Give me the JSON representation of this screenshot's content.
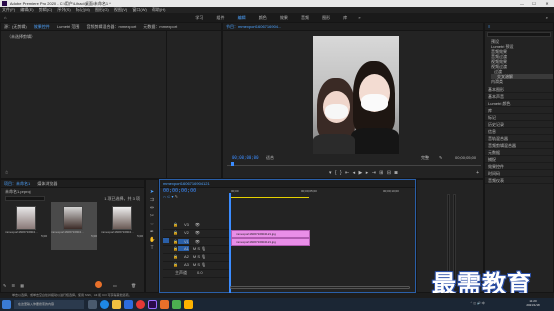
{
  "window": {
    "title": "Adobe Premiere Pro 2020 - C:\\用户\\Lihao\\桌面\\未命名1 *"
  },
  "menu": [
    "文件(F)",
    "编辑(E)",
    "剪辑(C)",
    "序列(S)",
    "标记(M)",
    "图形(G)",
    "视图(V)",
    "窗口(W)",
    "帮助(H)"
  ],
  "workspaces": [
    "学习",
    "组件",
    "编辑",
    "颜色",
    "效果",
    "音频",
    "图形",
    "库"
  ],
  "source_panel": {
    "tabs": [
      "源：(无剪辑)",
      "效果控件",
      "Lumetri 范围",
      "音频剪辑混合器：mmexport",
      "元数据：mmexport"
    ],
    "empty_text": "（未选择剪辑）"
  },
  "program_panel": {
    "tabs": [
      "节目：mmexport1606716904..."
    ],
    "timecode": "00;00;00;00",
    "fit": "适合",
    "quality": "完整",
    "duration": "00;00;05;00"
  },
  "project_panel": {
    "tabs": [
      "项目：未命名1",
      "媒体浏览器"
    ],
    "file": "未命名1.prproj",
    "count": "1 项已选择，共 3 项",
    "items": [
      {
        "name": "mmexport1606716904...",
        "dur": "5;00"
      },
      {
        "name": "mmexport1606716904...",
        "dur": "5;00"
      },
      {
        "name": "mmexport1606716904...",
        "dur": "5;00"
      }
    ]
  },
  "timeline": {
    "tab": "mmexport1606716904121",
    "timecode": "00;00;00;00",
    "ruler": [
      "00;00",
      "00;00;05;00",
      "00;00;10;00"
    ],
    "tracks": [
      "V3",
      "V2",
      "V1",
      "A1",
      "A2",
      "A3",
      "主声道"
    ],
    "master_value": "0.0",
    "clips": [
      {
        "label": "mmexport1606716904121.jpg"
      },
      {
        "label": "mmexport1606716904121.jpg"
      }
    ]
  },
  "effects_panel": {
    "search_placeholder": "",
    "tree": [
      "预设",
      "Lumetri 预设",
      "音频效果",
      "音频过渡",
      "视频效果",
      "视频过渡",
      "过渡",
      "交叉溶解",
      "内滑类"
    ],
    "sections": [
      "基本图形",
      "基本声音",
      "Lumetri 颜色",
      "库",
      "标记",
      "历史记录",
      "信息",
      "音轨混合器",
      "音频剪辑混合器",
      "元数据",
      "捕捉",
      "效果控件",
      "时间码",
      "音频仪表"
    ]
  },
  "taskbar": {
    "search_text": "在这里输入你要搜索的内容",
    "hint": "单击以选择，或单击空白处并拖动以进行框选择。使用 Shift、Alt 和 Ctrl 可获得其他选项。",
    "time": "11:20",
    "date": "2021/1/18"
  },
  "watermark": "最需教育",
  "colors": {
    "accent": "#3b8cff",
    "clip": "#e98ee8",
    "yellow_bar": "#e5d100"
  }
}
